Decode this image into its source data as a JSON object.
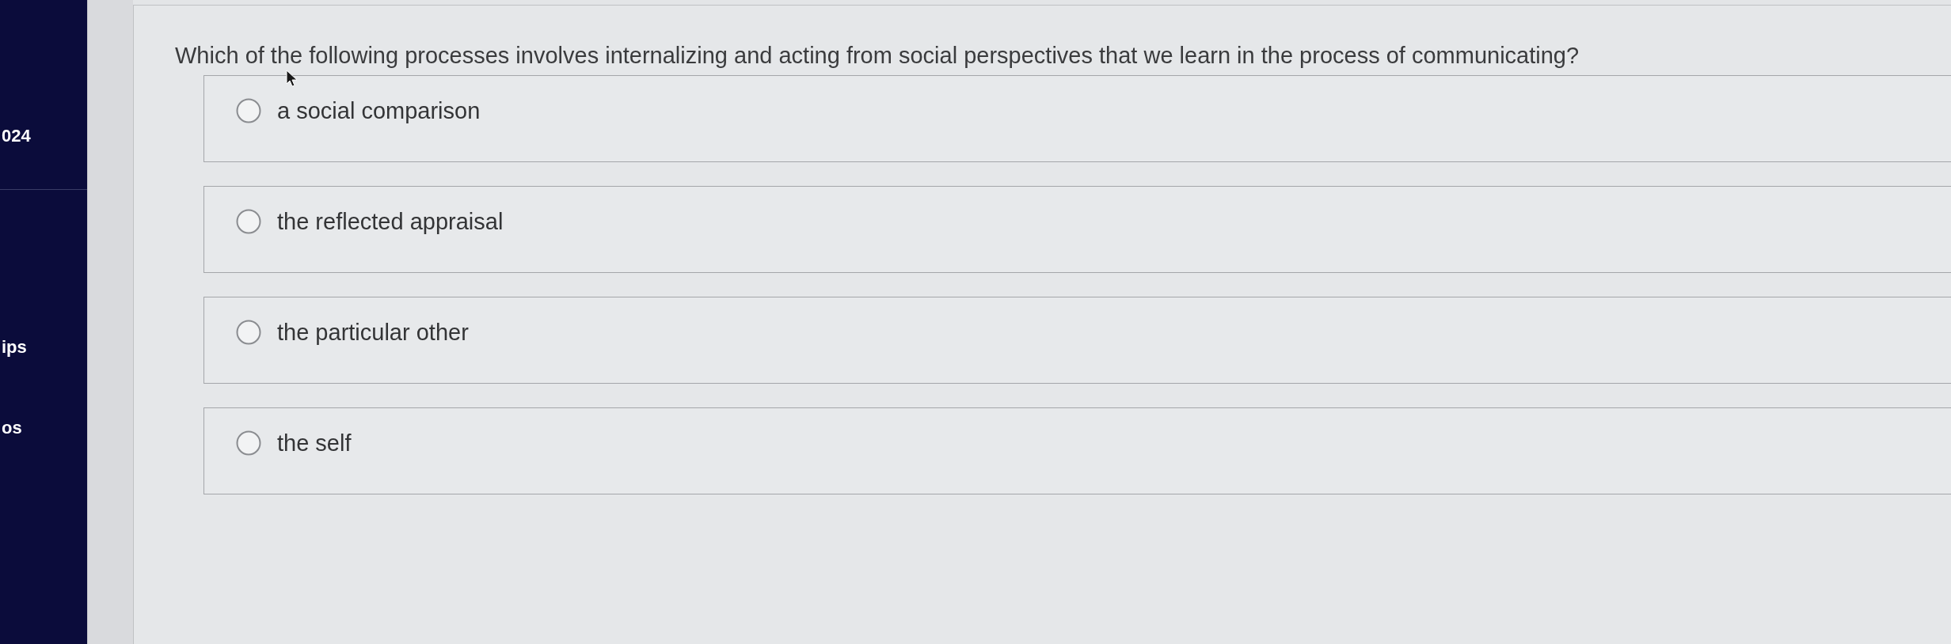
{
  "sidebar": {
    "header": "024",
    "items": [
      {
        "label": "ips"
      },
      {
        "label": "os"
      }
    ]
  },
  "question": {
    "text": "Which of the following processes involves internalizing and acting from social perspectives that we learn in the process of communicating?",
    "options": [
      {
        "label": "a social comparison",
        "selected": false
      },
      {
        "label": "the reflected appraisal",
        "selected": false
      },
      {
        "label": "the particular other",
        "selected": false
      },
      {
        "label": "the self",
        "selected": false
      }
    ]
  }
}
